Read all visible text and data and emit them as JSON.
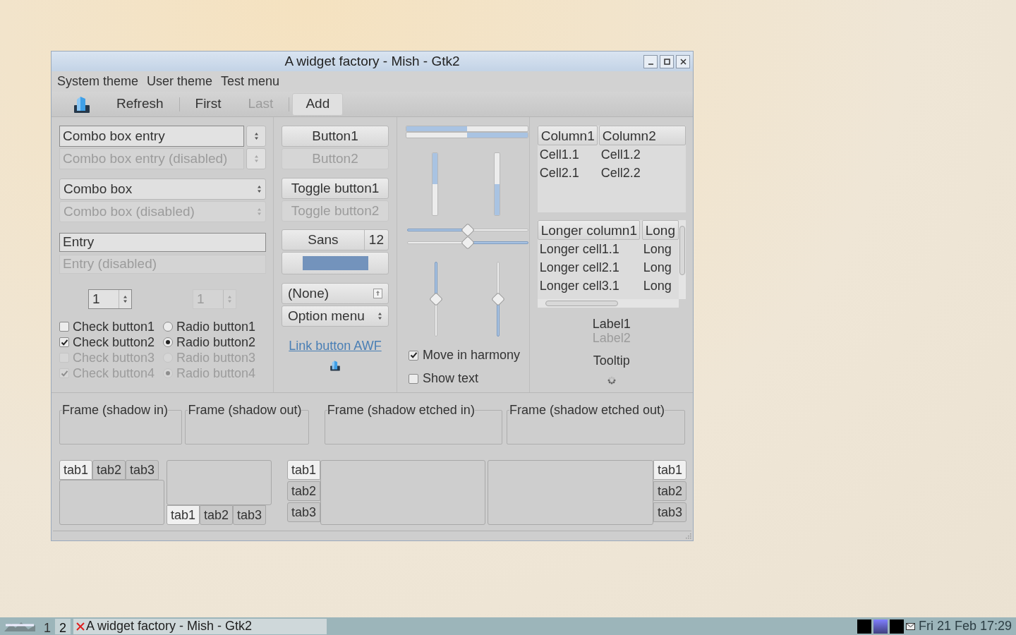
{
  "window": {
    "title": "A widget factory - Mish - Gtk2"
  },
  "menu": [
    "System theme",
    "User theme",
    "Test menu"
  ],
  "toolbar": [
    {
      "kind": "icon"
    },
    {
      "kind": "button",
      "label": "Refresh",
      "disabled": false,
      "pressed": false
    },
    {
      "kind": "separator"
    },
    {
      "kind": "button",
      "label": "First",
      "disabled": false,
      "pressed": false
    },
    {
      "kind": "button",
      "label": "Last",
      "disabled": true,
      "pressed": false
    },
    {
      "kind": "separator"
    },
    {
      "kind": "button",
      "label": "Add",
      "disabled": false,
      "pressed": true
    }
  ],
  "combo_entries": [
    {
      "value": "Combo box entry",
      "disabled": false
    },
    {
      "value": "Combo box entry (disabled)",
      "disabled": true
    }
  ],
  "combos": [
    {
      "value": "Combo box",
      "disabled": false
    },
    {
      "value": "Combo box (disabled)",
      "disabled": true
    }
  ],
  "entries": [
    {
      "value": "Entry",
      "disabled": false
    },
    {
      "value": "Entry (disabled)",
      "disabled": true
    }
  ],
  "spin_buttons": [
    {
      "value": "1",
      "disabled": false
    },
    {
      "value": "1",
      "disabled": true
    }
  ],
  "check_buttons": [
    {
      "label": "Check button1",
      "checked": false,
      "disabled": false
    },
    {
      "label": "Check button2",
      "checked": true,
      "disabled": false
    },
    {
      "label": "Check button3",
      "checked": false,
      "disabled": true
    },
    {
      "label": "Check button4",
      "checked": true,
      "disabled": true
    }
  ],
  "radio_buttons": [
    {
      "label": "Radio button1",
      "selected": false,
      "disabled": false
    },
    {
      "label": "Radio button2",
      "selected": true,
      "disabled": false
    },
    {
      "label": "Radio button3",
      "selected": false,
      "disabled": true
    },
    {
      "label": "Radio button4",
      "selected": true,
      "disabled": true
    }
  ],
  "buttons": [
    {
      "label": "Button1",
      "disabled": false
    },
    {
      "label": "Button2",
      "disabled": true
    }
  ],
  "toggle_buttons": [
    {
      "label": "Toggle button1",
      "disabled": false
    },
    {
      "label": "Toggle button2",
      "disabled": true
    }
  ],
  "font_button": {
    "font": "Sans",
    "size": "12"
  },
  "color_button": {
    "color": "#7393bc"
  },
  "file_chooser": {
    "label": "(None)"
  },
  "option_menu": {
    "label": "Option menu"
  },
  "link_button": {
    "label": "Link button AWF"
  },
  "progress_bars": [
    {
      "level": 0.5,
      "inverted": false
    },
    {
      "level": 0.5,
      "inverted": true
    }
  ],
  "vertical_progress_bars": [
    {
      "level": 0.5,
      "inverted": false
    },
    {
      "level": 0.5,
      "inverted": true
    }
  ],
  "scales": [
    {
      "level": 0.5,
      "inverted": false
    },
    {
      "level": 0.5,
      "inverted": true
    }
  ],
  "vertical_scales": [
    {
      "level": 0.5,
      "inverted": false
    },
    {
      "level": 0.5,
      "inverted": true
    }
  ],
  "scale_options": [
    {
      "label": "Move in harmony",
      "checked": true
    },
    {
      "label": "Show text",
      "checked": false
    }
  ],
  "tree": {
    "columns": [
      "Column1",
      "Column2"
    ],
    "rows": [
      [
        "Cell1.1",
        "Cell1.2"
      ],
      [
        "Cell2.1",
        "Cell2.2"
      ]
    ]
  },
  "scrolled_tree": {
    "columns": [
      "Longer column1",
      "Long"
    ],
    "rows": [
      [
        "Longer cell1.1",
        "Long"
      ],
      [
        "Longer cell2.1",
        "Long"
      ],
      [
        "Longer cell3.1",
        "Long"
      ]
    ]
  },
  "labels": [
    {
      "label": "Label1",
      "disabled": false
    },
    {
      "label": "Label2",
      "disabled": true
    }
  ],
  "tooltip_label": "Tooltip",
  "frames": [
    "Frame (shadow in)",
    "Frame (shadow out)",
    "Frame (shadow etched in)",
    "Frame (shadow etched out)"
  ],
  "notebooks": [
    {
      "kind": "top",
      "tabs": [
        {
          "label": "tab1",
          "selected": true
        },
        {
          "label": "tab2",
          "selected": false
        },
        {
          "label": "tab3",
          "selected": false
        }
      ]
    },
    {
      "kind": "bottom",
      "tabs": [
        {
          "label": "tab1",
          "selected": true
        },
        {
          "label": "tab2",
          "selected": false
        },
        {
          "label": "tab3",
          "selected": false
        }
      ]
    },
    {
      "kind": "left",
      "tabs": [
        {
          "label": "tab1",
          "selected": true
        },
        {
          "label": "tab2",
          "selected": false
        },
        {
          "label": "tab3",
          "selected": false
        }
      ]
    },
    {
      "kind": "right",
      "tabs": [
        {
          "label": "tab1",
          "selected": true
        },
        {
          "label": "tab2",
          "selected": false
        },
        {
          "label": "tab3",
          "selected": false
        }
      ]
    }
  ],
  "taskbar": {
    "workspaces": [
      {
        "label": "1",
        "selected": false
      },
      {
        "label": "2",
        "selected": true
      }
    ],
    "task": "A widget factory - Mish - Gtk2",
    "clock": "Fri 21 Feb 17:29"
  }
}
